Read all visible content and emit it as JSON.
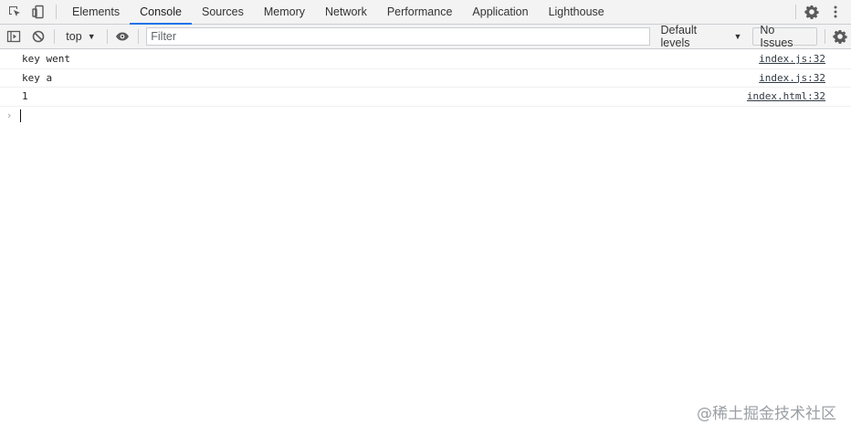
{
  "tabs": [
    {
      "label": "Elements"
    },
    {
      "label": "Console"
    },
    {
      "label": "Sources"
    },
    {
      "label": "Memory"
    },
    {
      "label": "Network"
    },
    {
      "label": "Performance"
    },
    {
      "label": "Application"
    },
    {
      "label": "Lighthouse"
    }
  ],
  "active_tab": "Console",
  "toolbar": {
    "context": "top",
    "filter_placeholder": "Filter",
    "levels": "Default levels",
    "issues": "No Issues"
  },
  "messages": [
    {
      "text": "key went",
      "source": "index.js:32"
    },
    {
      "text": "key a",
      "source": "index.js:32"
    },
    {
      "text": "1",
      "source": "index.html:32"
    }
  ],
  "watermark": "@稀土掘金技术社区",
  "icons": {
    "inspect": "inspect-element-icon",
    "device": "device-toolbar-icon",
    "settings": "gear-icon",
    "more": "more-vertical-icon",
    "sidebar": "sidebar-toggle-icon",
    "clear": "clear-console-icon",
    "eye": "eye-icon"
  },
  "colors": {
    "accent": "#1a73e8",
    "toolbar_bg": "#f3f3f3"
  }
}
